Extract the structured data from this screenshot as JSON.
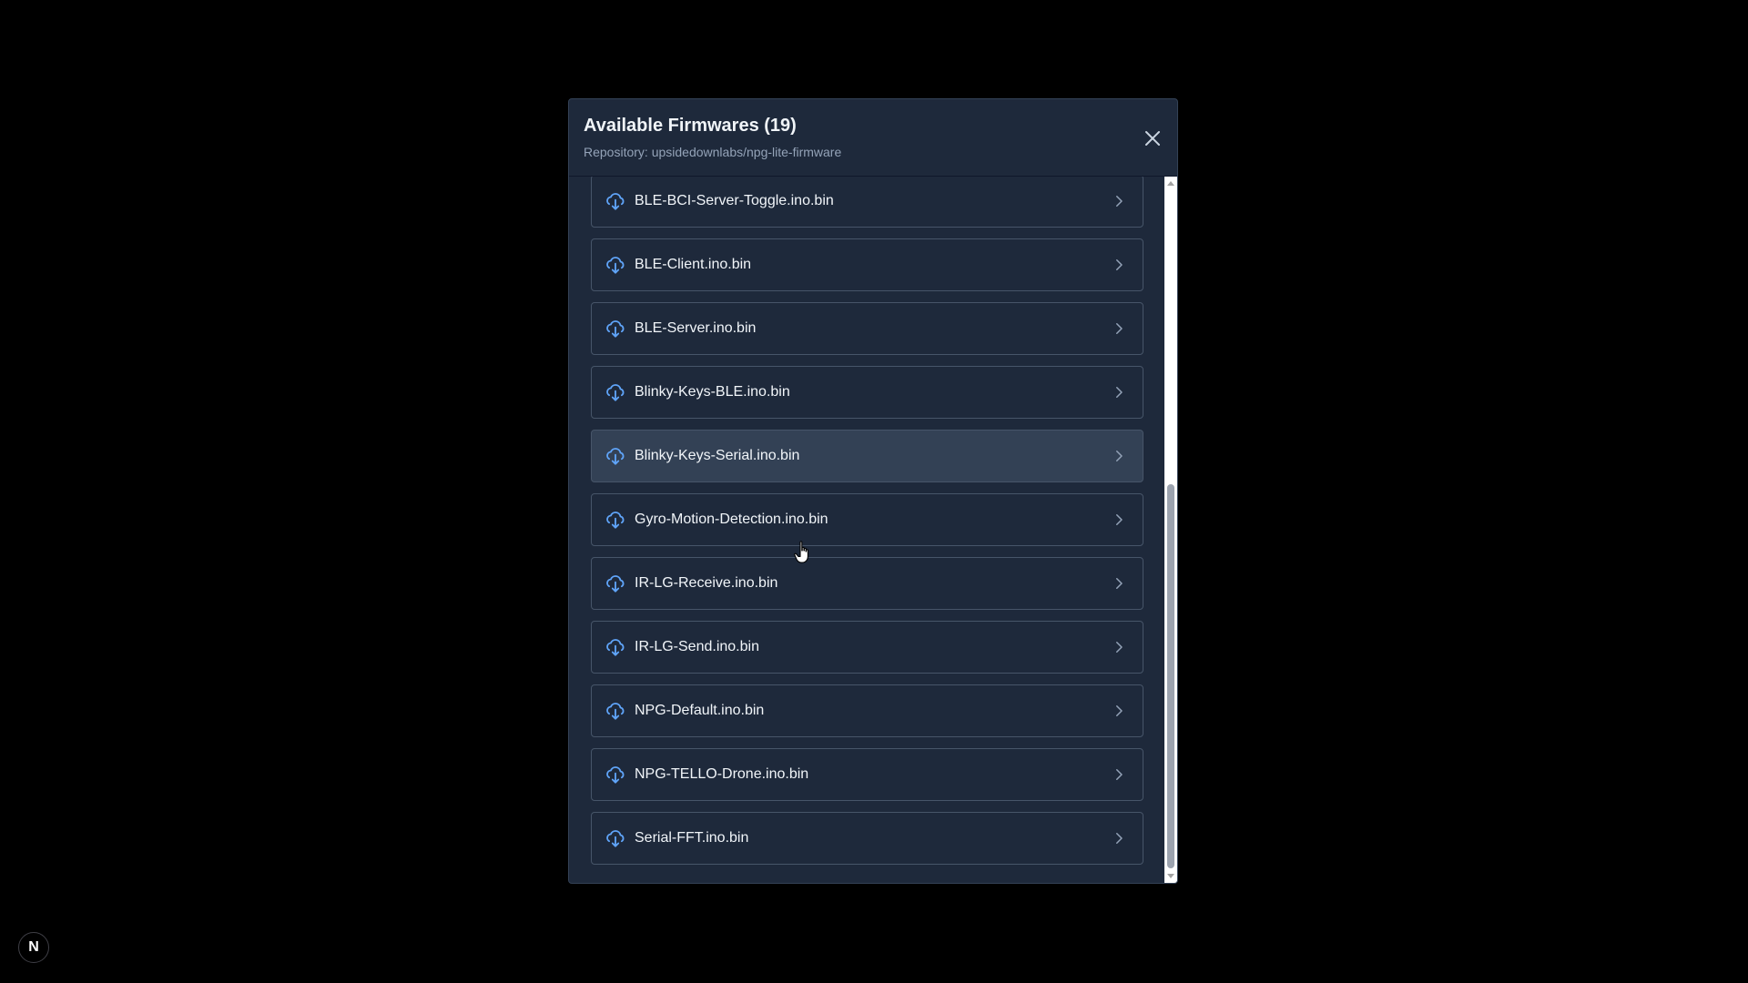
{
  "modal": {
    "title": "Available Firmwares (19)",
    "subtitle": "Repository: upsidedownlabs/npg-lite-firmware",
    "close_icon": "close-icon"
  },
  "firmwares": [
    "BLE-BCI-Server-Toggle.ino.bin",
    "BLE-Client.ino.bin",
    "BLE-Server.ino.bin",
    "Blinky-Keys-BLE.ino.bin",
    "Blinky-Keys-Serial.ino.bin",
    "Gyro-Motion-Detection.ino.bin",
    "IR-LG-Receive.ino.bin",
    "IR-LG-Send.ino.bin",
    "NPG-Default.ino.bin",
    "NPG-TELLO-Drone.ino.bin",
    "Serial-FFT.ino.bin"
  ],
  "item_icon": "cloud-download-icon",
  "item_chevron_icon": "chevron-right-icon",
  "hovered_item": "Blinky-Keys-Serial.ino.bin",
  "colors": {
    "accent": "#60a5fa",
    "modal_bg": "#1e293b",
    "item_border": "#475569",
    "hover_bg": "#334155"
  },
  "dev_badge": "N"
}
